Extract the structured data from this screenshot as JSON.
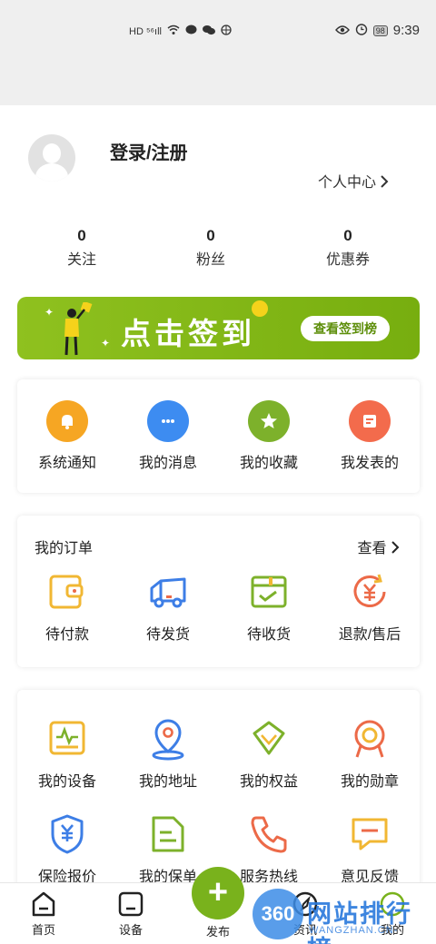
{
  "status_bar": {
    "left_icons": "HD ⁵⁶ıll",
    "battery": "98",
    "time": "9:39"
  },
  "profile": {
    "login_label": "登录/注册",
    "personal_center": "个人中心",
    "chevron": "›"
  },
  "stats": [
    {
      "value": "0",
      "label": "关注"
    },
    {
      "value": "0",
      "label": "粉丝"
    },
    {
      "value": "0",
      "label": "优惠券"
    }
  ],
  "banner": {
    "text": "点击签到",
    "button": "查看签到榜"
  },
  "quick": [
    {
      "label": "系统通知",
      "icon": "bell-icon",
      "color": "#f6a623"
    },
    {
      "label": "我的消息",
      "icon": "chat-icon",
      "color": "#3d8cf1"
    },
    {
      "label": "我的收藏",
      "icon": "star-icon",
      "color": "#7db12b"
    },
    {
      "label": "我发表的",
      "icon": "document-icon",
      "color": "#f36b4c"
    }
  ],
  "orders": {
    "title": "我的订单",
    "more": "查看",
    "items": [
      {
        "label": "待付款",
        "icon": "wallet-icon"
      },
      {
        "label": "待发货",
        "icon": "truck-icon"
      },
      {
        "label": "待收货",
        "icon": "package-icon"
      },
      {
        "label": "退款/售后",
        "icon": "refund-icon"
      }
    ]
  },
  "services": [
    {
      "label": "我的设备",
      "icon": "device-icon"
    },
    {
      "label": "我的地址",
      "icon": "location-icon"
    },
    {
      "label": "我的权益",
      "icon": "diamond-icon"
    },
    {
      "label": "我的勋章",
      "icon": "medal-icon"
    },
    {
      "label": "保险报价",
      "icon": "insurance-icon"
    },
    {
      "label": "我的保单",
      "icon": "policy-icon"
    },
    {
      "label": "服务热线",
      "icon": "phone-icon"
    },
    {
      "label": "意见反馈",
      "icon": "feedback-icon"
    }
  ],
  "nav": {
    "home": "首页",
    "device": "设备",
    "publish": "发布",
    "news": "资讯",
    "mine": "我的",
    "plus": "+"
  },
  "watermark": {
    "badge": "360",
    "text": "网站排行榜",
    "sub": "WANGZHAN.CN-"
  },
  "colors": {
    "brand_green": "#79b21c",
    "yellow": "#f1b733",
    "blue": "#3d7ee6",
    "green": "#7db12b",
    "red": "#ec6a48"
  }
}
